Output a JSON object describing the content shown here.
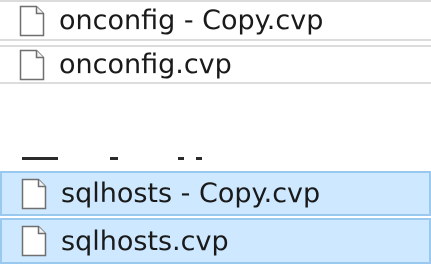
{
  "files": [
    {
      "name": "onconfig - Copy.cvp",
      "icon": "document-icon",
      "selected": false
    },
    {
      "name": "onconfig.cvp",
      "icon": "document-icon",
      "selected": false
    },
    {
      "name": "sqlhosts - Copy.cvp",
      "icon": "document-icon",
      "selected": true
    },
    {
      "name": "sqlhosts.cvp",
      "icon": "document-icon",
      "selected": true
    }
  ],
  "colors": {
    "selection_fill": "#cde8ff",
    "selection_border": "#99c9ef",
    "row_border": "#dcdcdc",
    "text": "#1a1a1a"
  }
}
